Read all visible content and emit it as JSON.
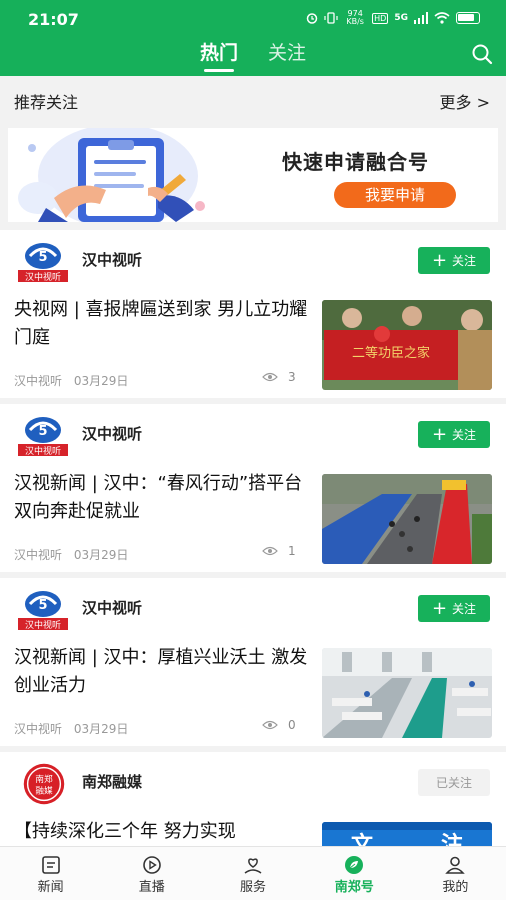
{
  "status_bar": {
    "time": "21:07",
    "net_speed": "974 KB/s",
    "hd": "HD",
    "network": "5G"
  },
  "header": {
    "tabs": [
      {
        "label": "热门",
        "active": true
      },
      {
        "label": "关注",
        "active": false
      }
    ],
    "accent_color": "#16b05a"
  },
  "recommend": {
    "title": "推荐关注",
    "more": "更多 >"
  },
  "banner": {
    "title": "快速申请融合号",
    "button": "我要申请",
    "button_color": "#f26a1b"
  },
  "cards": [
    {
      "author": "汉中视听",
      "avatar_text": "汉中视听",
      "follow": "关注",
      "followed": false,
      "headline": "央视网 | 喜报牌匾送到家 男儿立功耀门庭",
      "source": "汉中视听",
      "date": "03月29日",
      "views": "3",
      "thumb_text": "二等功臣之家"
    },
    {
      "author": "汉中视听",
      "avatar_text": "汉中视听",
      "follow": "关注",
      "followed": false,
      "headline": "汉视新闻 | 汉中：“春风行动”搭平台 双向奔赴促就业",
      "source": "汉中视听",
      "date": "03月29日",
      "views": "1"
    },
    {
      "author": "汉中视听",
      "avatar_text": "汉中视听",
      "follow": "关注",
      "followed": false,
      "headline": "汉视新闻 | 汉中：厚植兴业沃土 激发创业活力",
      "source": "汉中视听",
      "date": "03月29日",
      "views": "0"
    },
    {
      "author": "南郑融媒",
      "avatar_text": "南郑融媒",
      "follow": "已关注",
      "followed": true,
      "headline": "【持续深化三个年 努力实现"
    }
  ],
  "bottom_nav": [
    {
      "label": "新闻",
      "icon": "news-icon",
      "active": false
    },
    {
      "label": "直播",
      "icon": "live-icon",
      "active": false
    },
    {
      "label": "服务",
      "icon": "service-icon",
      "active": false
    },
    {
      "label": "南郑号",
      "icon": "leaf-icon",
      "active": true
    },
    {
      "label": "我的",
      "icon": "user-icon",
      "active": false
    }
  ]
}
